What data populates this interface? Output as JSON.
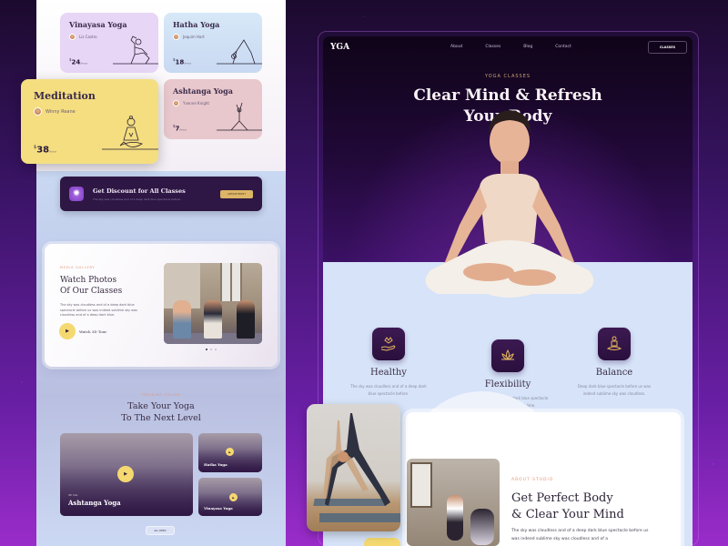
{
  "classes_panel": {
    "cards": [
      {
        "title": "Vinayasa Yoga",
        "instructor": "Liz Castro",
        "price": "24",
        "currency": "$",
        "unit": "/hour",
        "color": "#e7d6f6"
      },
      {
        "title": "Hatha Yoga",
        "instructor": "Jequim Hart",
        "price": "18",
        "currency": "$",
        "unit": "/hour",
        "color": "#d7e8f8"
      },
      {
        "title": "Meditation",
        "instructor": "Winny Reane",
        "price": "38",
        "currency": "$",
        "unit": "/hour",
        "color": "#f4de80"
      },
      {
        "title": "Ashtanga Yoga",
        "instructor": "Yvonne Knight",
        "price": "7",
        "currency": "$",
        "unit": "/hour",
        "color": "#e8c8cc"
      }
    ],
    "discount": {
      "title": "Get Discount for All Classes",
      "subtitle": "The sky was cloudless and of a deep dark blue spectacle before.",
      "button": "APPOINTMENT"
    },
    "gallery": {
      "eyebrow": "MEDIA GALLERY",
      "heading_line1": "Watch Photos",
      "heading_line2": "Of Our Classes",
      "description": "The sky was cloudless and of a deep dark blue spectacle before us was indeed sublime sky was cloudless and of a deep dark blue.",
      "tour_label": "Watch 3D Tour",
      "slides_total": 3,
      "slide_active": 1
    },
    "training": {
      "eyebrow": "TRAINING ONLINE",
      "heading_line1": "Take Your Yoga",
      "heading_line2": "To The Next Level",
      "videos": [
        {
          "title": "Ashtanga Yoga",
          "meta": "45 min"
        },
        {
          "title": "Hatha Yoga"
        },
        {
          "title": "Vinayasa Yoga"
        }
      ],
      "all_button": "ALL VIDEO"
    }
  },
  "landing": {
    "logo": "YGA",
    "nav": [
      "About",
      "Classes",
      "Blog",
      "Contact"
    ],
    "nav_cta": "CLASSES",
    "hero": {
      "eyebrow": "YOGA CLASSES",
      "title_line1": "Clear Mind & Refresh",
      "title_line2": "Your Body"
    },
    "features": [
      {
        "icon": "lotus-hand-icon",
        "title": "Healthy",
        "line1": "The sky was cloudless and of a deep dark",
        "line2": "blue spectacle before."
      },
      {
        "icon": "lotus-icon",
        "title": "Flexibility",
        "line1": "Cloudless and of a deep dark blue spectacle",
        "line2": "before us was indeed sublime."
      },
      {
        "icon": "meditation-icon",
        "title": "Balance",
        "line1": "Deep dark blue spectacle before us was",
        "line2": "indeed sublime sky was cloudless."
      }
    ],
    "about": {
      "eyebrow": "ABOUT STUDIO",
      "heading_line1": "Get Perfect Body",
      "heading_line2": "& Clear Your Mind",
      "description": "The sky was cloudless and of a deep dark blue spectacle before us was indeed sublime sky was cloudless and of a"
    }
  },
  "colors": {
    "accent_gold": "#dcb567",
    "dark_purple": "#2e1744",
    "play_yellow": "#f5d970",
    "eyebrow_coral": "#e3967a"
  }
}
